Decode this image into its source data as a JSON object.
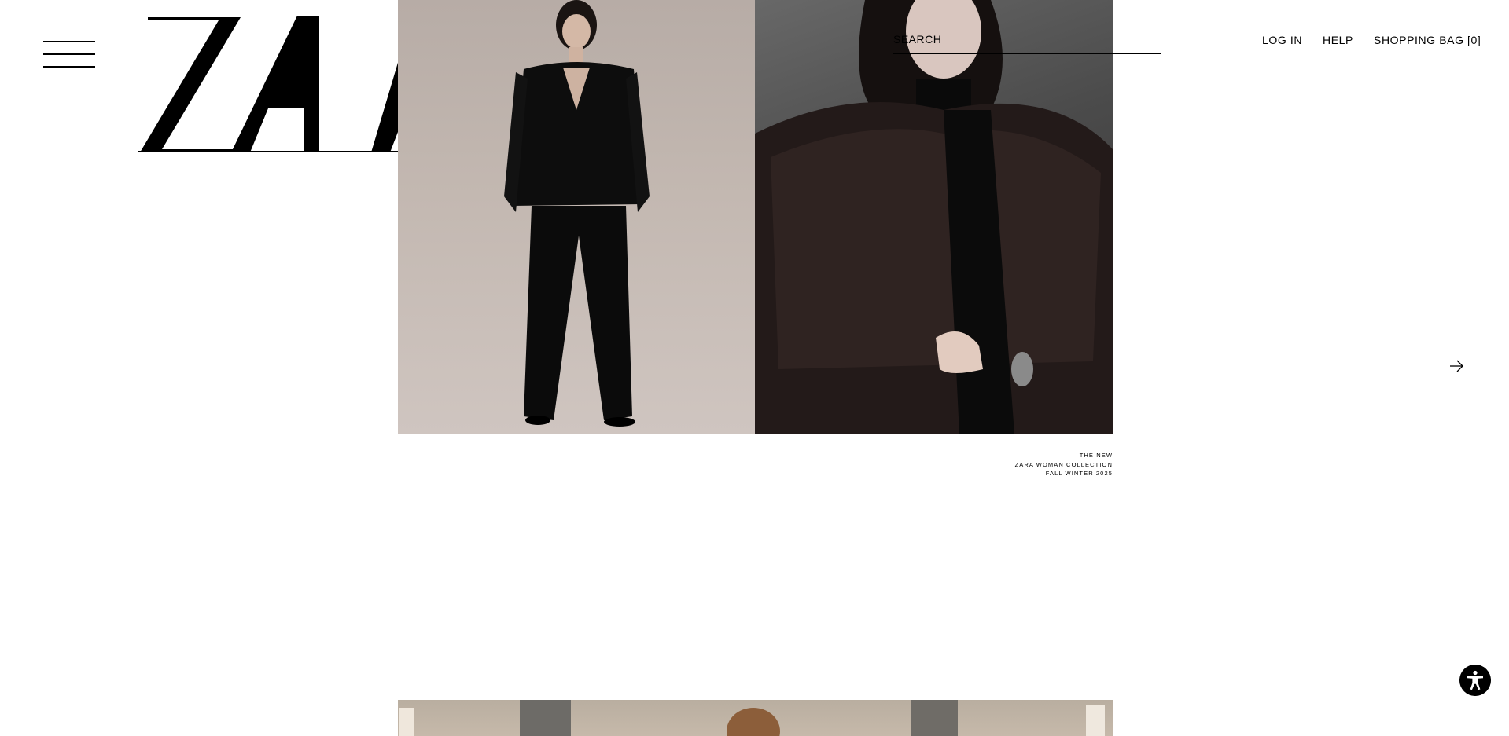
{
  "header": {
    "logo_text": "ZARA",
    "search": {
      "placeholder": "SEARCH",
      "value": ""
    },
    "nav": {
      "login": "LOG IN",
      "help": "HELP",
      "bag": "SHOPPING BAG [0]"
    }
  },
  "hero": {
    "caption_lines": [
      "THE NEW",
      "ZARA WOMAN COLLECTION",
      "FALL WINTER 2025"
    ]
  },
  "icons": {
    "menu": "hamburger-icon",
    "next": "arrow-right-icon",
    "accessibility": "accessibility-icon"
  },
  "colors": {
    "background": "#ffffff",
    "text": "#000000"
  }
}
